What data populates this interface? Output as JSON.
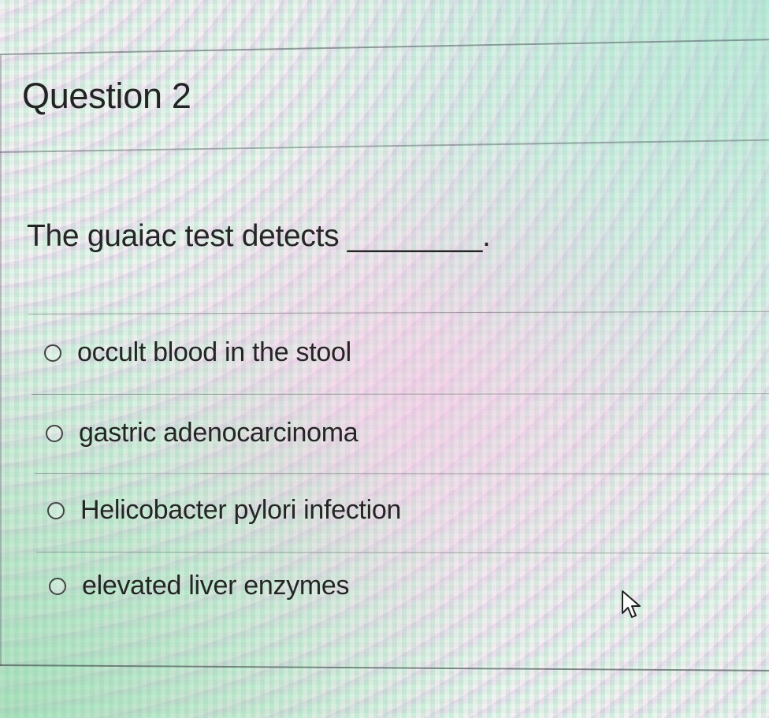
{
  "question": {
    "title": "Question 2",
    "prompt": "The guaiac test detects ________."
  },
  "options": [
    {
      "label": "occult blood in the stool",
      "selected": false
    },
    {
      "label": "gastric adenocarcinoma",
      "selected": false
    },
    {
      "label": "Helicobacter pylori infection",
      "selected": false
    },
    {
      "label": "elevated liver enzymes",
      "selected": false
    }
  ],
  "cursor": {
    "icon": "mouse-pointer-icon"
  }
}
